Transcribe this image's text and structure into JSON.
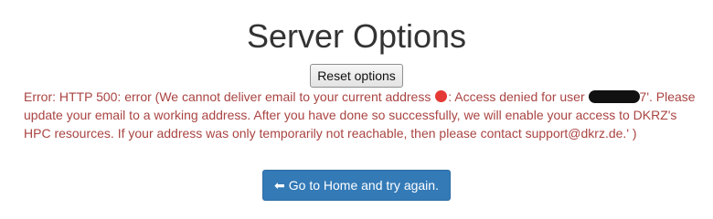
{
  "page": {
    "title": "Server Options"
  },
  "reset": {
    "label": "Reset options"
  },
  "error": {
    "prefix": "Error: HTTP 500: error (We cannot deliver email to your current address ",
    "middle": ": Access denied for user ",
    "suffix": "7'. Please update your email to a working address. After you have done so successfully, we will enable your access to DKRZ's HPC resources. If your address was only temporarily not reachable, then please contact support@dkrz.de.' )"
  },
  "home": {
    "arrow_icon": "arrow-left-icon",
    "label": "Go to Home and try again."
  },
  "colors": {
    "error_text": "#a94442",
    "primary_button": "#337ab7"
  }
}
